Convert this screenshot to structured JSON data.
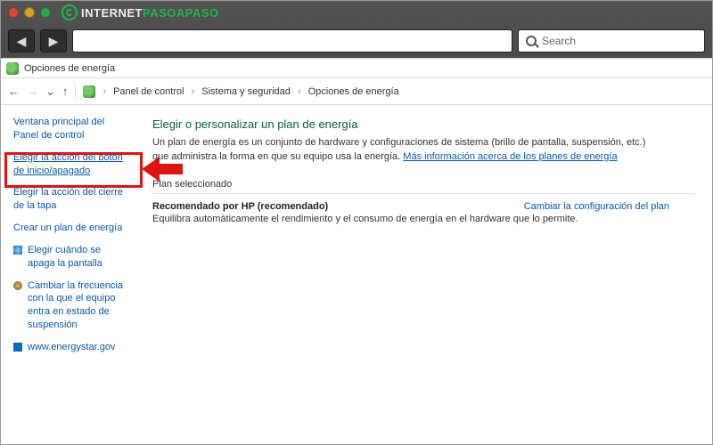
{
  "chrome": {
    "brand_a": "INTERNET",
    "brand_b": "PASOAPASO",
    "search_placeholder": "Search"
  },
  "titlebar": {
    "text": "Opciones de energía"
  },
  "breadcrumbs": {
    "items": [
      "Panel de control",
      "Sistema y seguridad",
      "Opciones de energía"
    ]
  },
  "sidebar": {
    "home": "Ventana principal del Panel de control",
    "l1": "Elegir la acción del botón de inicio/apagado",
    "l2": "Elegir la acción del cierre de la tapa",
    "l3": "Crear un plan de energía",
    "l4": "Elegir cuándo se apaga la pantalla",
    "l5": "Cambiar la frecuencia con la que el equipo entra en estado de suspensión",
    "l6": "www.energystar.gov"
  },
  "main": {
    "heading": "Elegir o personalizar un plan de energía",
    "desc_1": "Un plan de energía es un conjunto de hardware y configuraciones de sistema (brillo de pantalla, suspensión, etc.) que administra la forma en que su equipo usa la energía. ",
    "more_link": "Más información acerca de los planes de energía",
    "section": "Plan seleccionado",
    "plan_name": "Recomendado por HP (recomendado)",
    "plan_action": "Cambiar la configuración del plan",
    "plan_desc": "Equilibra automáticamente el rendimiento y el consumo de energía en el hardware que lo permite."
  }
}
